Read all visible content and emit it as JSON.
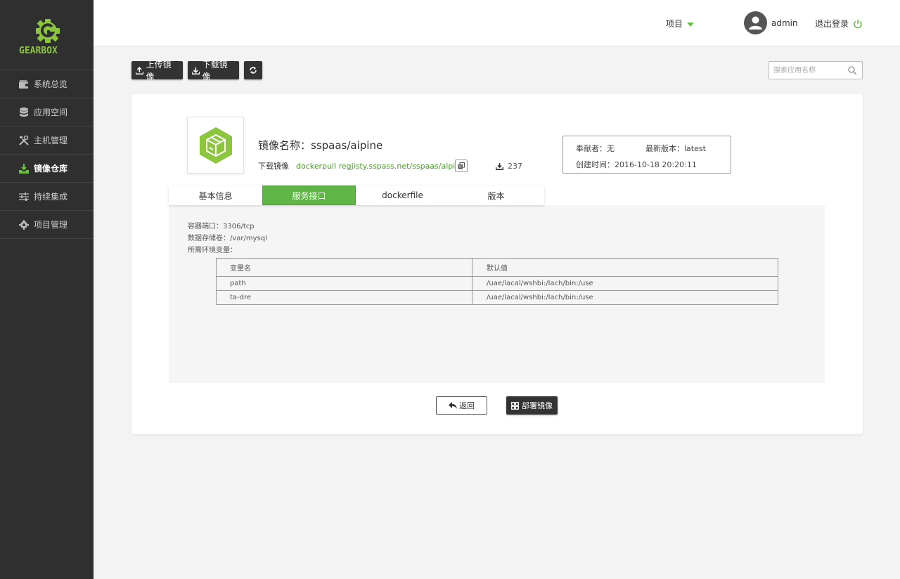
{
  "brand": {
    "name": "GEARBOX",
    "accent": "#6cbd45"
  },
  "sidebar": {
    "items": [
      {
        "label": "系统总览",
        "icon": "wallet-icon"
      },
      {
        "label": "应用空间",
        "icon": "database-icon"
      },
      {
        "label": "主机管理",
        "icon": "tools-icon"
      },
      {
        "label": "镜像仓库",
        "icon": "download-tray-icon",
        "active": true
      },
      {
        "label": "持续集成",
        "icon": "sliders-icon"
      },
      {
        "label": "项目管理",
        "icon": "gear-icon"
      }
    ]
  },
  "header": {
    "project_label": "项目",
    "username": "admin",
    "logout_label": "退出登录"
  },
  "toolbar": {
    "upload_label": "上传镜像",
    "download_label": "下载镜像",
    "search_placeholder": "搜索应用名称"
  },
  "image": {
    "name_label": "镜像名称：",
    "name": "sspaas/aipine",
    "download_label": "下载镜像",
    "pull_command": "dockerpull regjisty.sspass.net/sspaas/alpir",
    "download_count": "237",
    "contributor": "奉献者：无",
    "latest_version": "最新版本：latest",
    "created": "创建时间：2016-10-18 20:20:11"
  },
  "tabs": [
    {
      "label": "基本信息"
    },
    {
      "label": "服务接口",
      "active": true
    },
    {
      "label": "dockerfile"
    },
    {
      "label": "版本"
    }
  ],
  "service": {
    "port": "容器端口：3306/tcp",
    "volume": "数据存储卷：/var/mysql",
    "env_label": "所需环境变量：",
    "columns": [
      "变量名",
      "默认值"
    ],
    "rows": [
      [
        "path",
        "/uae/lacal/wshbi:/lach/bin:/use"
      ],
      [
        "ta-dre",
        "/uae/lacal/wshbi:/lach/bin:/use"
      ]
    ]
  },
  "actions": {
    "back_label": "返回",
    "deploy_label": "部署镜像"
  }
}
